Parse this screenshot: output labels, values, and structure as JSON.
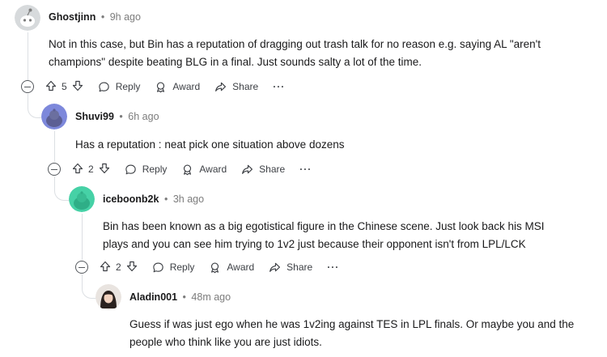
{
  "actions": {
    "reply_label": "Reply",
    "award_label": "Award",
    "share_label": "Share",
    "more_label": "···"
  },
  "comments": [
    {
      "username": "Ghostjinn",
      "separator": "•",
      "time": "9h ago",
      "lines": [
        "Not in this case, but Bin has a reputation of dragging out trash talk for no reason e.g. saying AL \"aren't",
        "champions\" despite beating BLG in a final. Just sounds salty a lot of the time."
      ],
      "score": "5",
      "avatar": "snoo-grey-icon"
    },
    {
      "username": "Shuvi99",
      "separator": "•",
      "time": "6h ago",
      "lines": [
        "Has a reputation : neat pick one situation above dozens"
      ],
      "score": "2",
      "avatar": "snoo-blue-icon"
    },
    {
      "username": "iceboonb2k",
      "separator": "•",
      "time": "3h ago",
      "lines": [
        "Bin has been known as a big egotistical figure in the Chinese scene. Just look back his MSI",
        "plays and you can see him trying to 1v2 just because their opponent isn't from LPL/LCK"
      ],
      "score": "2",
      "avatar": "snoo-teal-icon"
    },
    {
      "username": "Aladin001",
      "separator": "•",
      "time": "48m ago",
      "lines": [
        "Guess if was just ego when he was 1v2ing against TES in LPL finals. Or maybe you and the",
        "people who think like you are just idiots."
      ],
      "avatar": "profile-photo-avatar"
    }
  ]
}
